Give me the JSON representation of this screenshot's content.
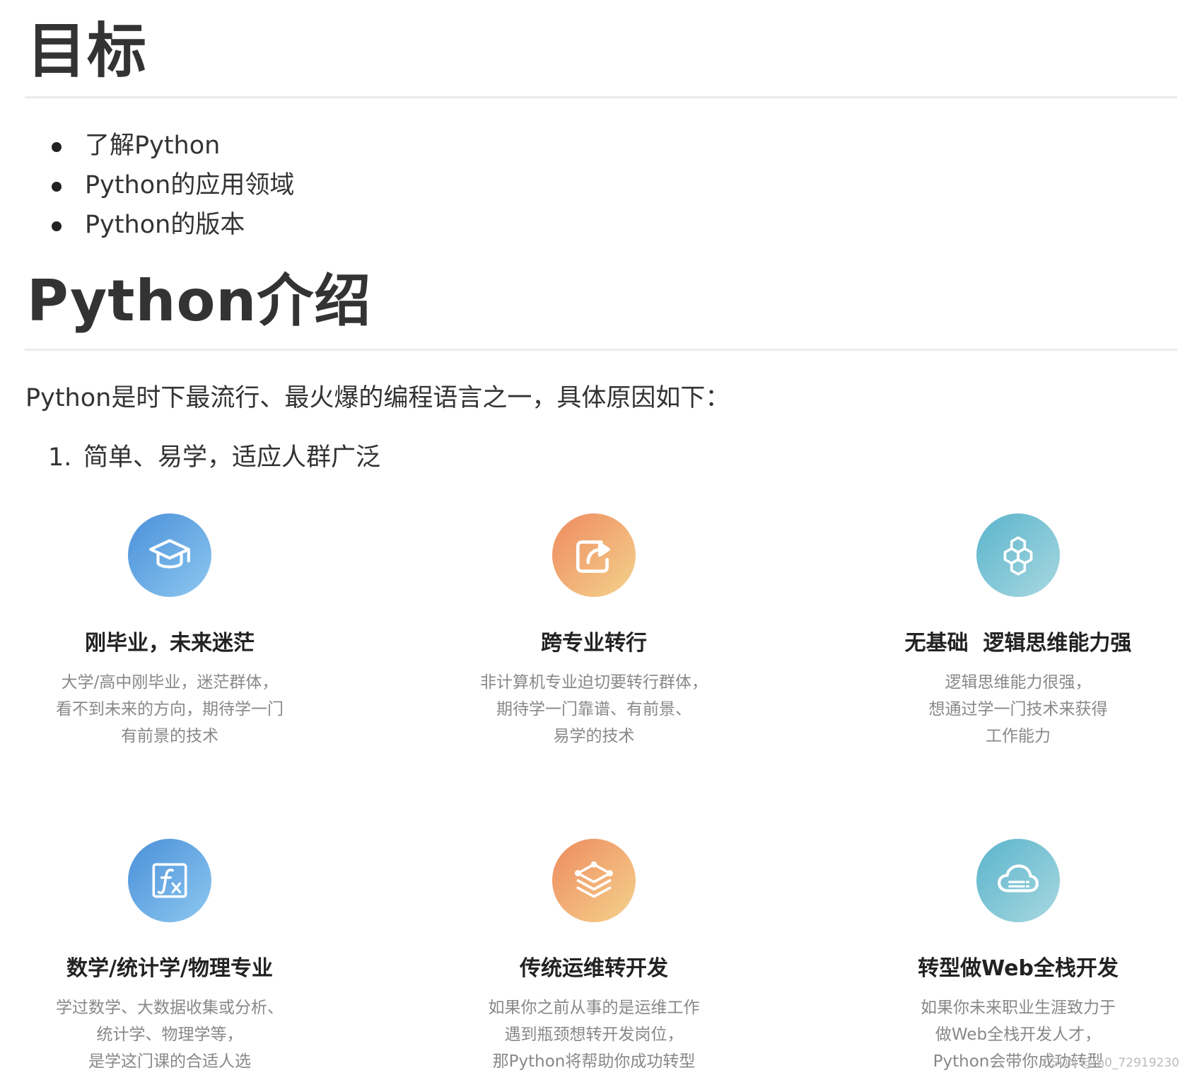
{
  "headings": {
    "goal": "目标",
    "intro": "Python介绍"
  },
  "goals": [
    "了解Python",
    "Python的应用领域",
    "Python的版本"
  ],
  "intro": {
    "paragraph": "Python是时下最流行、最火爆的编程语言之一，具体原因如下：",
    "list_number": "1.",
    "list_item": "简单、易学，适应人群广泛"
  },
  "cards": [
    {
      "icon": "graduation-cap-icon",
      "title": "刚毕业，未来迷茫",
      "lines": [
        "大学/高中刚毕业，迷茫群体，",
        "看不到未来的方向，期待学一门",
        "有前景的技术"
      ]
    },
    {
      "icon": "share-arrow-icon",
      "title": "跨专业转行",
      "lines": [
        "非计算机专业迫切要转行群体，",
        "期待学一门靠谱、有前景、",
        "易学的技术"
      ]
    },
    {
      "icon": "hexagon-molecule-icon",
      "title": "无基础  逻辑思维能力强",
      "lines": [
        "逻辑思维能力很强，",
        "想通过学一门技术来获得",
        "工作能力"
      ]
    },
    {
      "icon": "function-fx-icon",
      "title": "数学/统计学/物理专业",
      "lines": [
        "学过数学、大数据收集或分析、",
        "统计学、物理学等，",
        "是学这门课的合适人选"
      ]
    },
    {
      "icon": "layers-stack-icon",
      "title": "传统运维转开发",
      "lines": [
        "如果你之前从事的是运维工作",
        "遇到瓶颈想转开发岗位，",
        "那Python将帮助你成功转型"
      ]
    },
    {
      "icon": "cloud-icon",
      "title": "转型做Web全栈开发",
      "lines": [
        "如果你未来职业生涯致力于",
        "做Web全栈开发人才，",
        "Python会带你成功转型"
      ]
    }
  ],
  "watermark": "CSDN @m0_72919230",
  "colors": {
    "text": "#333333",
    "muted": "#888888",
    "rule": "#eaecef",
    "blue": "#4a90d9",
    "orange": "#ee8a5e",
    "teal": "#5ab4cc"
  }
}
